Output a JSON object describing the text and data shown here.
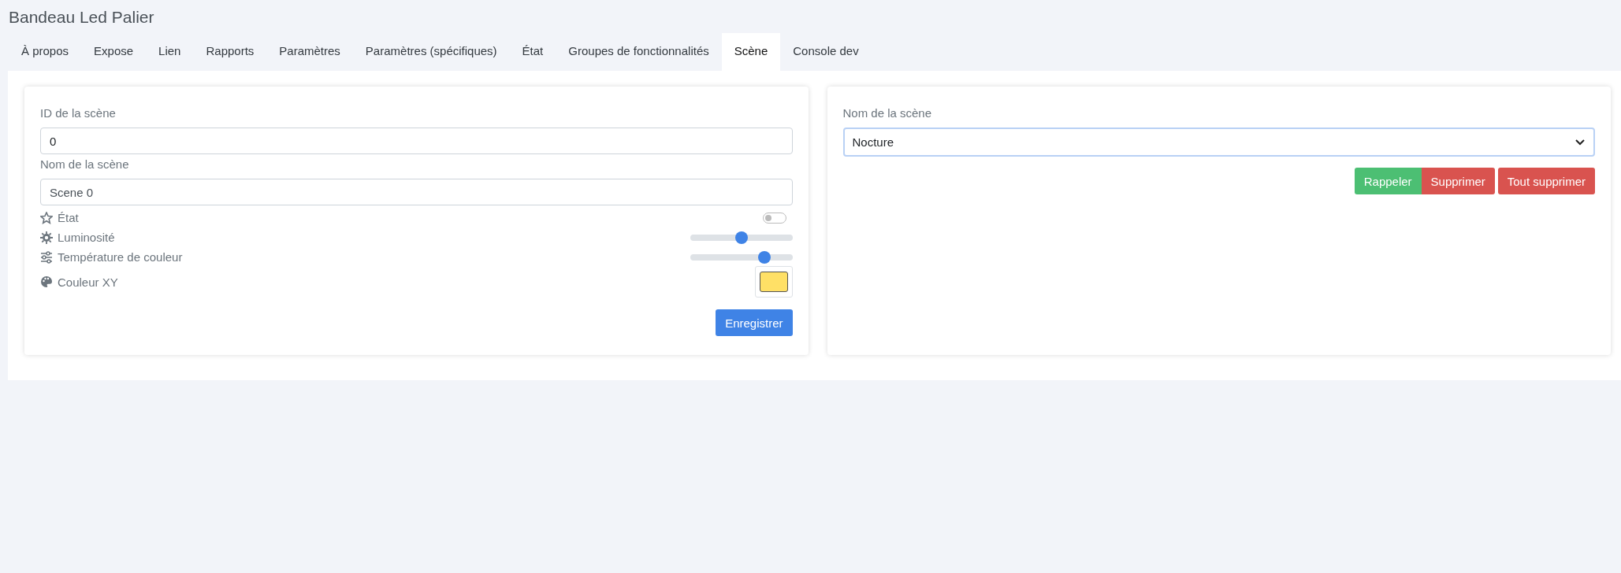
{
  "window": {
    "title": "Bandeau Led Palier"
  },
  "tabs": [
    {
      "label": "À propos",
      "selected": false
    },
    {
      "label": "Expose",
      "selected": false
    },
    {
      "label": "Lien",
      "selected": false
    },
    {
      "label": "Rapports",
      "selected": false
    },
    {
      "label": "Paramètres",
      "selected": false
    },
    {
      "label": "Paramètres (spécifiques)",
      "selected": false
    },
    {
      "label": "État",
      "selected": false
    },
    {
      "label": "Groupes de fonctionnalités",
      "selected": false
    },
    {
      "label": "Scène",
      "selected": true
    },
    {
      "label": "Console dev",
      "selected": false
    }
  ],
  "scene_form": {
    "id_label": "ID de la scène",
    "id_value": "0",
    "name_label": "Nom de la scène",
    "name_value": "Scene 0",
    "attributes": [
      {
        "kind": "toggle",
        "label": "État",
        "on": false
      },
      {
        "kind": "slider",
        "label": "Luminosité",
        "level": 0.5
      },
      {
        "kind": "slider",
        "label": "Température de couleur",
        "level": 0.73
      },
      {
        "kind": "color",
        "label": "Couleur XY",
        "color": "#ffe066"
      }
    ],
    "save_button": "Enregistrer"
  },
  "scene_actions": {
    "name_label": "Nom de la scène",
    "selected_scene": "Nocture",
    "buttons": [
      {
        "label": "Rappeler",
        "kind": "success"
      },
      {
        "label": "Supprimer",
        "kind": "danger"
      },
      {
        "label": "Tout supprimer",
        "kind": "danger"
      }
    ]
  }
}
